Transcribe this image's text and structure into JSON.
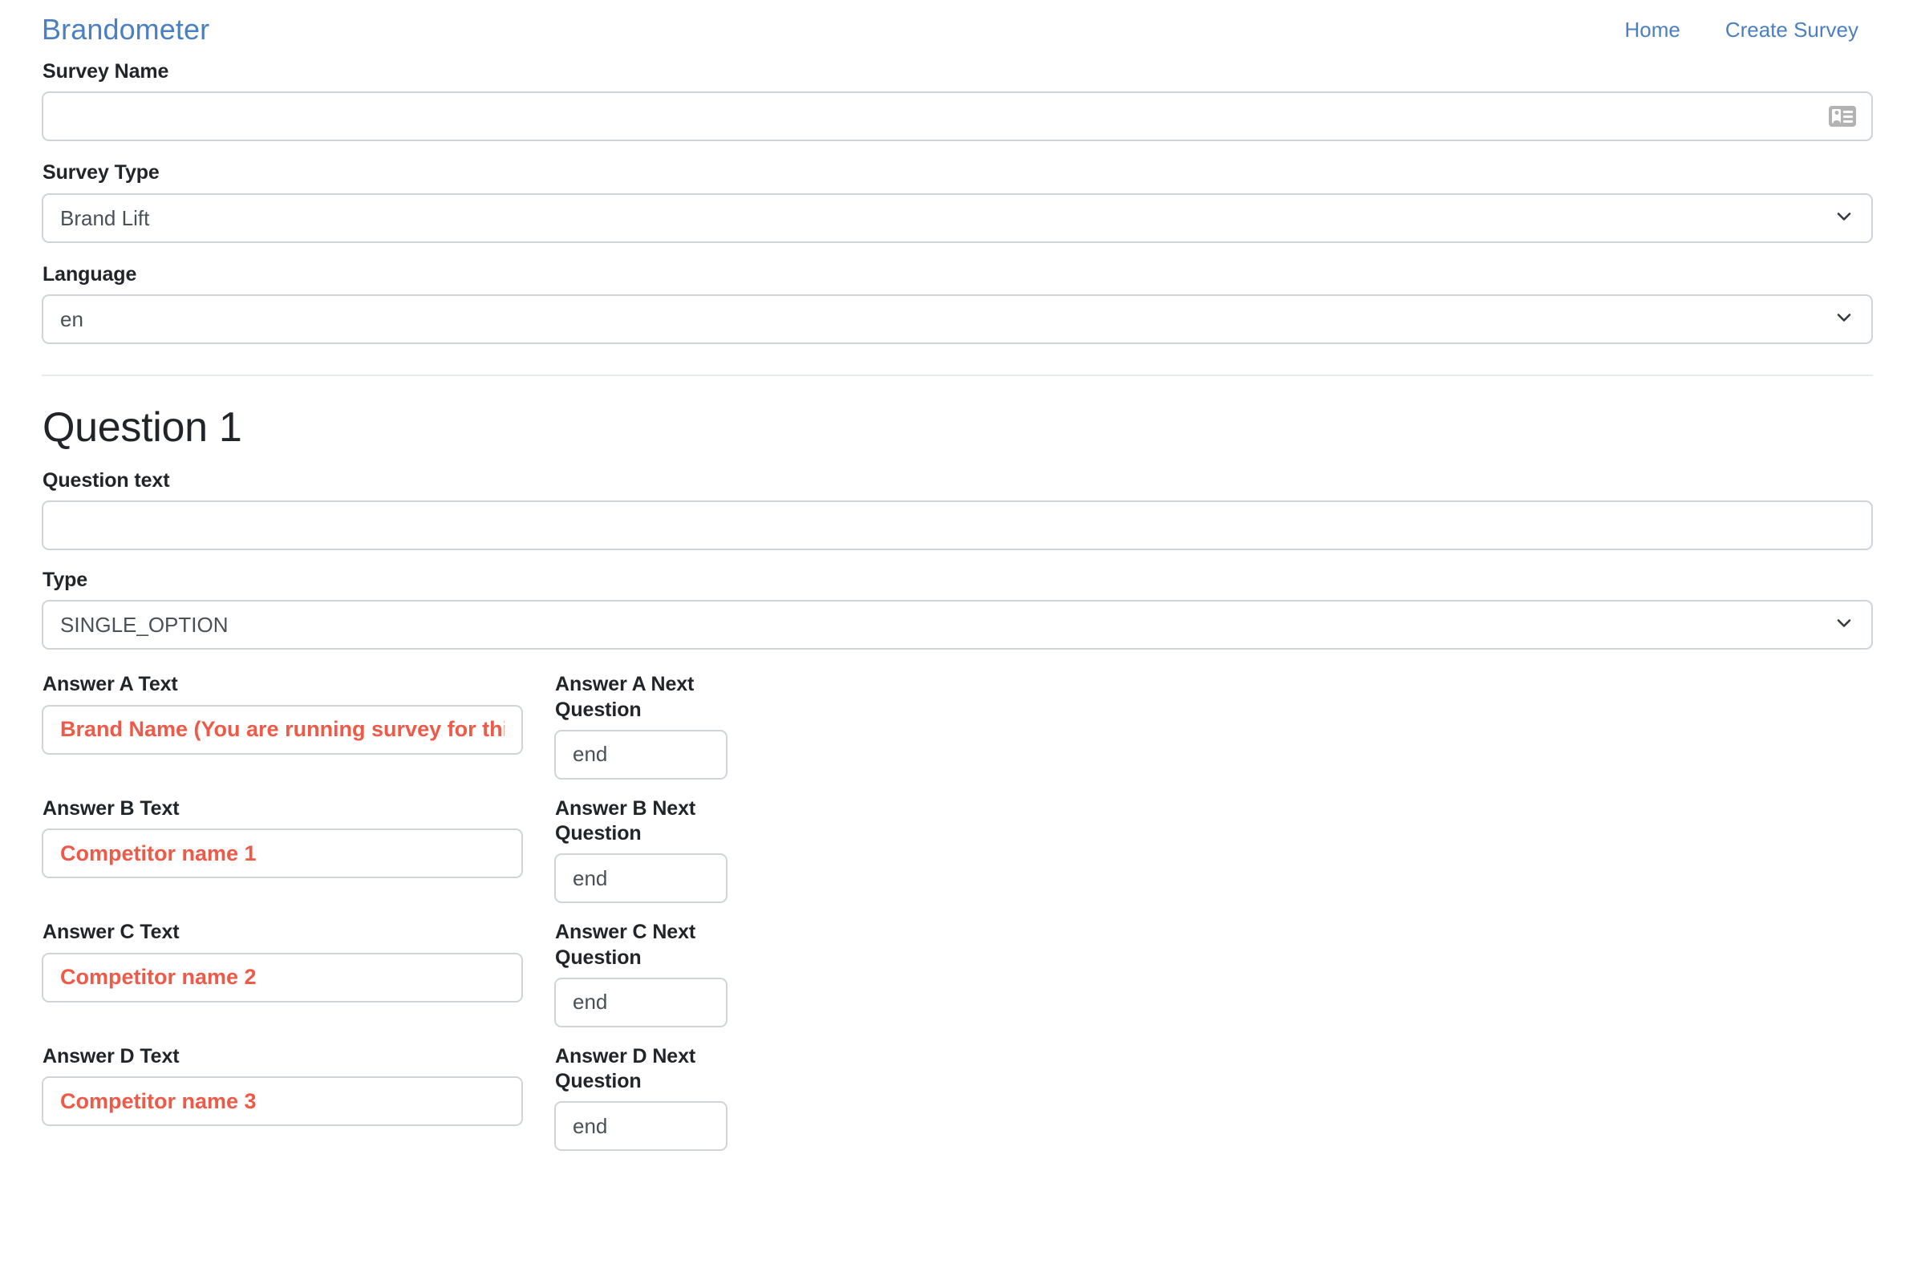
{
  "navbar": {
    "brand": "Brandometer",
    "links": [
      {
        "label": "Home",
        "name": "nav-link-home"
      },
      {
        "label": "Create Survey",
        "name": "nav-link-create-survey"
      }
    ]
  },
  "colors": {
    "brand_blue": "#4a7fc1",
    "answer_red": "#ee5a47",
    "border_grey": "#ced4da",
    "text_dark": "#212529",
    "input_text": "#495057",
    "divider": "#e9ecef"
  },
  "form": {
    "survey_name": {
      "label": "Survey Name",
      "value": "",
      "placeholder": "",
      "icon": "contact-card-icon"
    },
    "survey_type": {
      "label": "Survey Type",
      "selected": "Brand Lift",
      "options": [
        "Brand Lift"
      ],
      "icon": "chevron-down-icon"
    },
    "language": {
      "label": "Language",
      "selected": "en",
      "options": [
        "en"
      ],
      "icon": "chevron-down-icon"
    }
  },
  "question": {
    "heading": "Question 1",
    "question_text": {
      "label": "Question text",
      "value": "",
      "placeholder": ""
    },
    "type": {
      "label": "Type",
      "selected": "SINGLE_OPTION",
      "options": [
        "SINGLE_OPTION"
      ],
      "icon": "chevron-down-icon"
    },
    "answers": [
      {
        "text_label": "Answer A Text",
        "text_value": "Brand Name (You are running survey for this brand)",
        "next_label": "Answer A Next Question",
        "next_value": "end"
      },
      {
        "text_label": "Answer B Text",
        "text_value": "Competitor name 1",
        "next_label": "Answer B Next Question",
        "next_value": "end"
      },
      {
        "text_label": "Answer C Text",
        "text_value": "Competitor name 2",
        "next_label": "Answer C Next Question",
        "next_value": "end"
      },
      {
        "text_label": "Answer D Text",
        "text_value": "Competitor name 3",
        "next_label": "Answer D Next Question",
        "next_value": "end"
      }
    ]
  }
}
